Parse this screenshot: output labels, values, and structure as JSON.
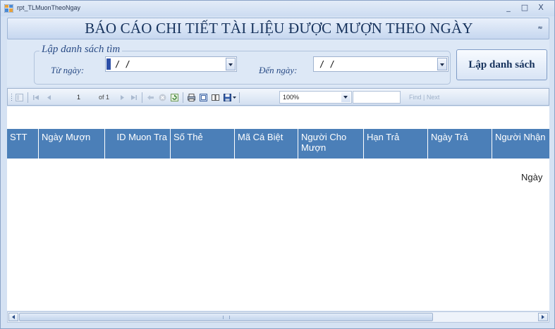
{
  "window": {
    "title": "rpt_TLMuonTheoNgay",
    "minimize": "_",
    "maximize": "□",
    "close": "X"
  },
  "header": {
    "title": "BÁO CÁO CHI TIẾT TÀI LIỆU ĐƯỢC MƯỢN THEO NGÀY",
    "collapse": "≈"
  },
  "search": {
    "group_label": "Lập danh sách tìm",
    "from_label": "Từ ngày:",
    "from_value": "/ /",
    "to_label": "Đến ngày:",
    "to_value": "/ /",
    "button": "Lập danh sách"
  },
  "toolbar": {
    "page": "1",
    "of": "of 1",
    "zoom": "100%",
    "find": "Find",
    "separator": "|",
    "next": "Next"
  },
  "table": {
    "columns": [
      "STT",
      "Ngày Mượn",
      "ID Muon Tra",
      "Số Thẻ",
      "Mã Cá Biệt",
      "Người Cho Mượn",
      "Hạn Trả",
      "Ngày Trả",
      "Người Nhận"
    ],
    "overflow_label": "Ngày"
  },
  "colors": {
    "header_band": "#d5e2f3",
    "table_header": "#4b7fb8",
    "title_text": "#16325c"
  }
}
